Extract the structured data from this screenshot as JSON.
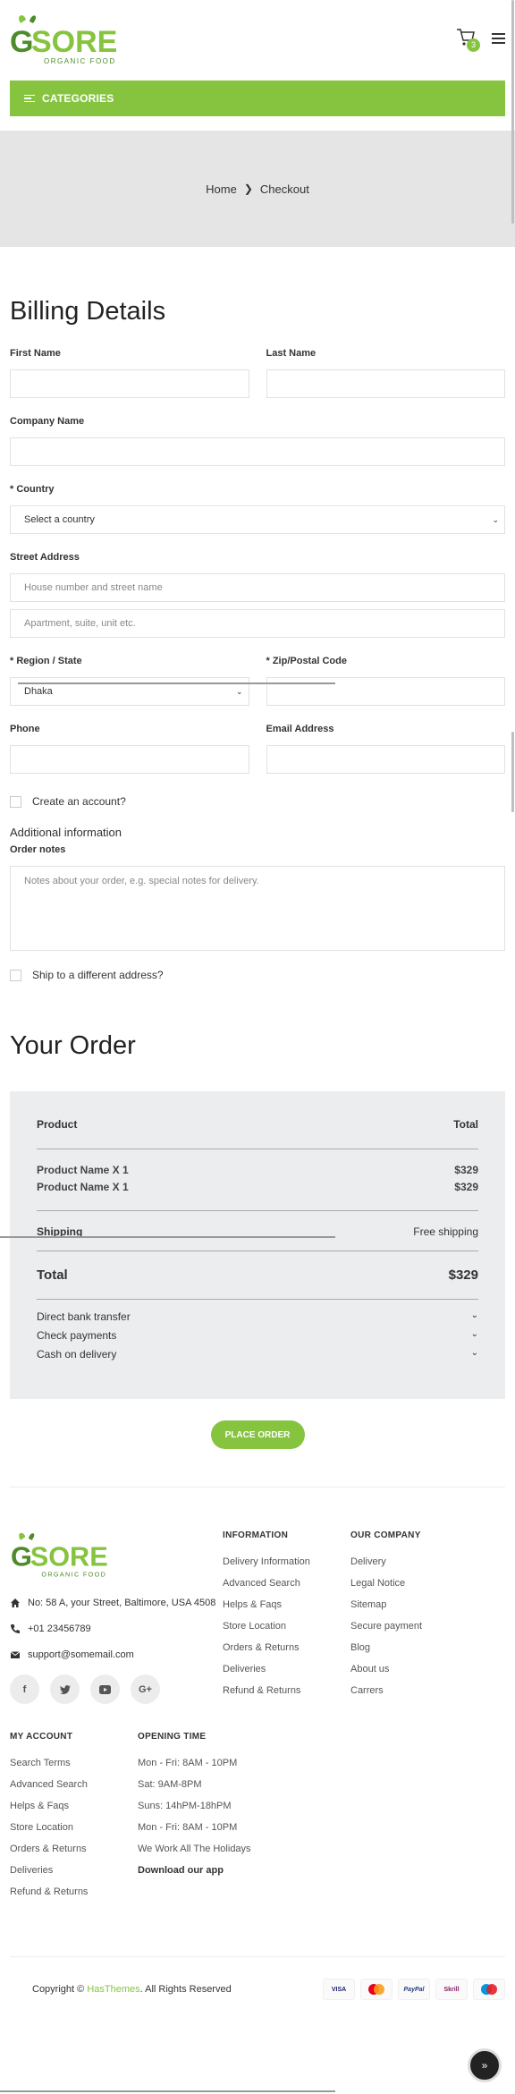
{
  "header": {
    "logo_text": "GSORE",
    "logo_tagline": "ORGANIC FOOD",
    "cart_count": "3",
    "categories_label": "CATEGORIES"
  },
  "breadcrumb": {
    "home": "Home",
    "current": "Checkout"
  },
  "billing": {
    "title": "Billing Details",
    "first_name_label": "First Name",
    "last_name_label": "Last Name",
    "company_label": "Company Name",
    "country_label": "* Country",
    "country_value": "Select a country",
    "street_label": "Street Address",
    "street_placeholder_1": "House number and street name",
    "street_placeholder_2": "Apartment, suite, unit etc.",
    "region_label": "* Region / State",
    "region_value": "Dhaka",
    "zip_label": "* Zip/Postal Code",
    "phone_label": "Phone",
    "email_label": "Email Address",
    "create_account": "Create an account?",
    "additional_title": "Additional information",
    "order_notes_label": "Order notes",
    "order_notes_placeholder": "Notes about your order, e.g. special notes for delivery.",
    "ship_different": "Ship to a different address?"
  },
  "order": {
    "title": "Your Order",
    "product_head": "Product",
    "total_head": "Total",
    "items": [
      {
        "name": "Product Name X 1",
        "price": "$329"
      },
      {
        "name": "Product Name X 1",
        "price": "$329"
      }
    ],
    "shipping_label": "Shipping",
    "shipping_value": "Free shipping",
    "total_label": "Total",
    "total_value": "$329",
    "payments": [
      "Direct bank transfer",
      "Check payments",
      "Cash on delivery"
    ],
    "place_order": "PLACE ORDER"
  },
  "footer": {
    "logo_text": "GSORE",
    "logo_tagline": "ORGANIC FOOD",
    "address": "No: 58 A, your Street, Baltimore, USA 4508",
    "phone": "+01 23456789",
    "email": "support@somemail.com",
    "information": {
      "title": "INFORMATION",
      "links": [
        "Delivery Information",
        "Advanced Search",
        "Helps & Faqs",
        "Store Location",
        "Orders & Returns",
        "Deliveries",
        "Refund & Returns"
      ]
    },
    "company": {
      "title": "OUR COMPANY",
      "links": [
        "Delivery",
        "Legal Notice",
        "Sitemap",
        "Secure payment",
        "Blog",
        "About us",
        "Carrers"
      ]
    },
    "account": {
      "title": "MY ACCOUNT",
      "links": [
        "Search Terms",
        "Advanced Search",
        "Helps & Faqs",
        "Store Location",
        "Orders & Returns",
        "Deliveries",
        "Refund & Returns"
      ]
    },
    "opening": {
      "title": "OPENING TIME",
      "lines": [
        "Mon - Fri: 8AM - 10PM",
        "Sat: 9AM-8PM",
        "Suns: 14hPM-18hPM",
        "Mon - Fri: 8AM - 10PM",
        "We Work All The Holidays"
      ],
      "download": "Download our app"
    },
    "copyright_prefix": "Copyright ©",
    "copyright_brand": "HasThemes",
    "copyright_suffix": ". All Rights Reserved",
    "payment_icons": [
      "VISA",
      "mastercard",
      "PayPal",
      "Skrill",
      "maestro"
    ]
  },
  "colors": {
    "accent": "#86c440",
    "dark": "#222222"
  }
}
